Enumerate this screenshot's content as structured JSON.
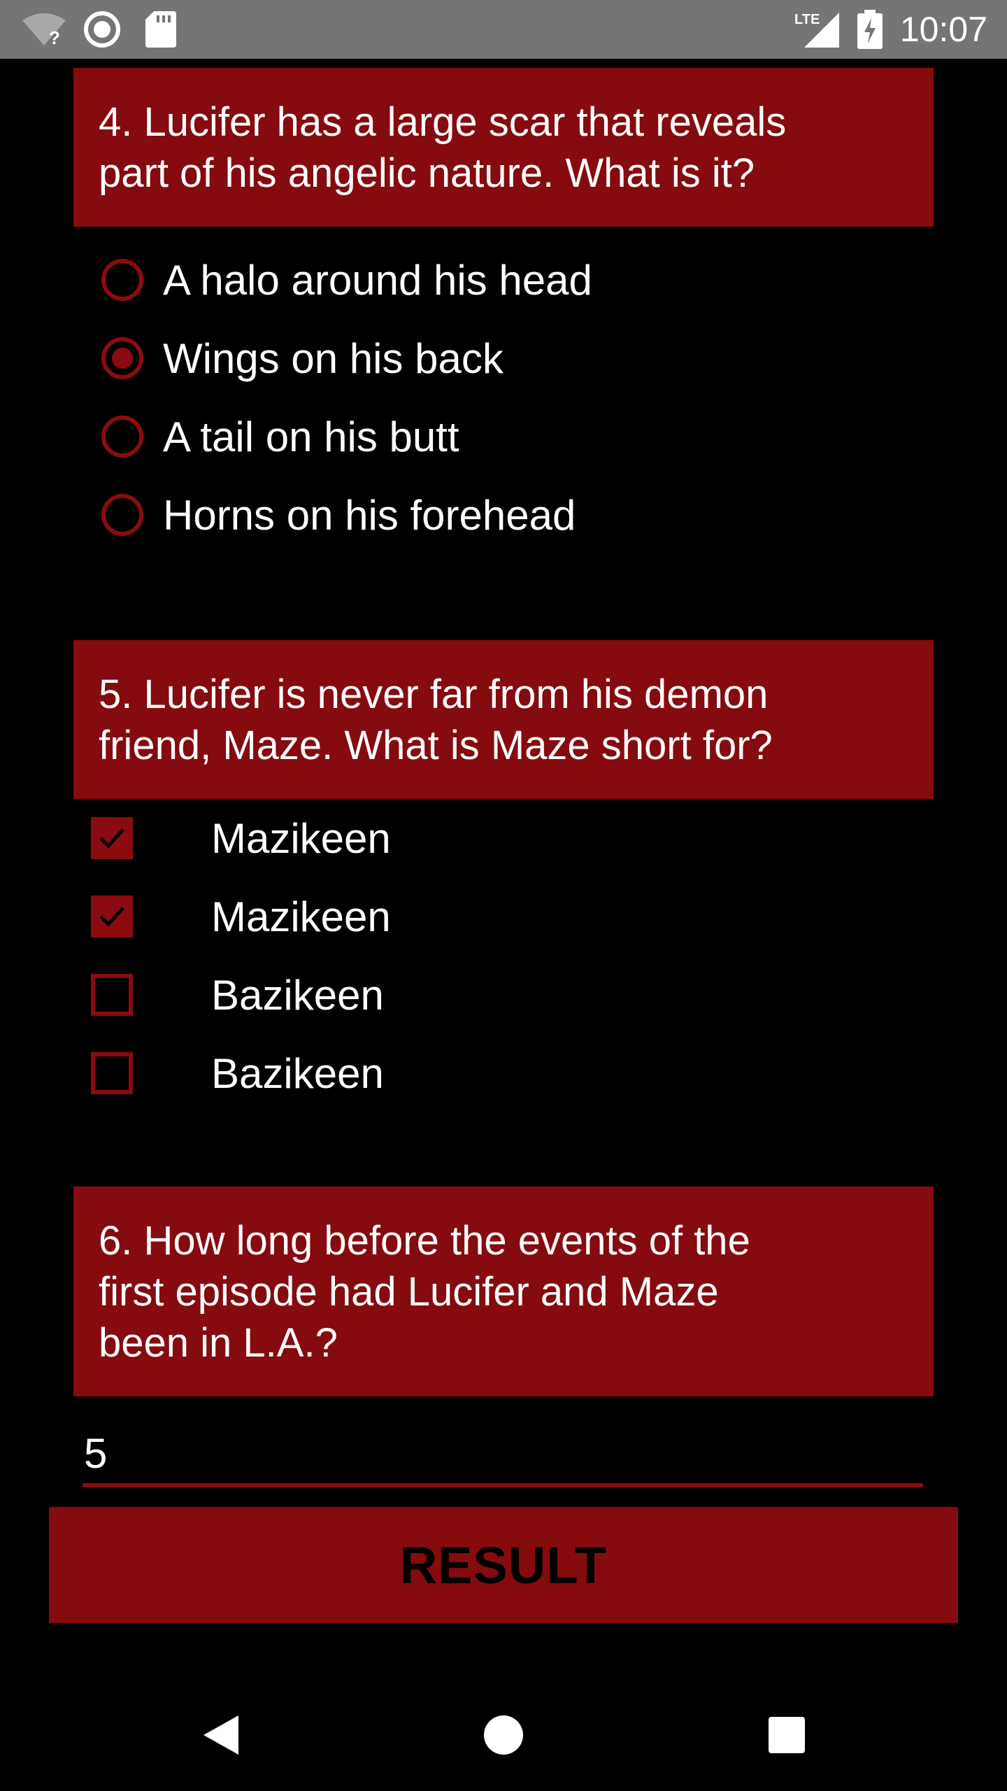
{
  "status_bar": {
    "time": "10:07",
    "network_label": "LTE",
    "icons": [
      "wifi-unknown-icon",
      "sync-icon",
      "sd-card-icon",
      "signal-icon",
      "battery-charging-icon"
    ]
  },
  "question4": {
    "text": "4. Lucifer has a large scar that reveals\npart of his angelic nature. What is it?",
    "options": [
      {
        "label": "A halo around his head",
        "selected": false
      },
      {
        "label": "Wings on his back",
        "selected": true
      },
      {
        "label": "A tail on his butt",
        "selected": false
      },
      {
        "label": "Horns on his forehead",
        "selected": false
      }
    ]
  },
  "question5": {
    "text": "5. Lucifer is never far from his demon\nfriend, Maze. What is Maze short for?",
    "options": [
      {
        "label": "Mazikeen",
        "checked": true
      },
      {
        "label": "Mazikeen",
        "checked": true
      },
      {
        "label": "Bazikeen",
        "checked": false
      },
      {
        "label": "Bazikeen",
        "checked": false
      }
    ]
  },
  "question6": {
    "text": "6. How long before the events of the\nfirst episode had Lucifer and Maze\nbeen in L.A.?",
    "answer_value": "5"
  },
  "result_button": {
    "label": "RESULT"
  },
  "colors": {
    "accent": "#850b0e",
    "background": "#000000",
    "status_bar": "#757575"
  },
  "nav_bar": {
    "icons": [
      "back-icon",
      "home-icon",
      "recents-icon"
    ]
  }
}
